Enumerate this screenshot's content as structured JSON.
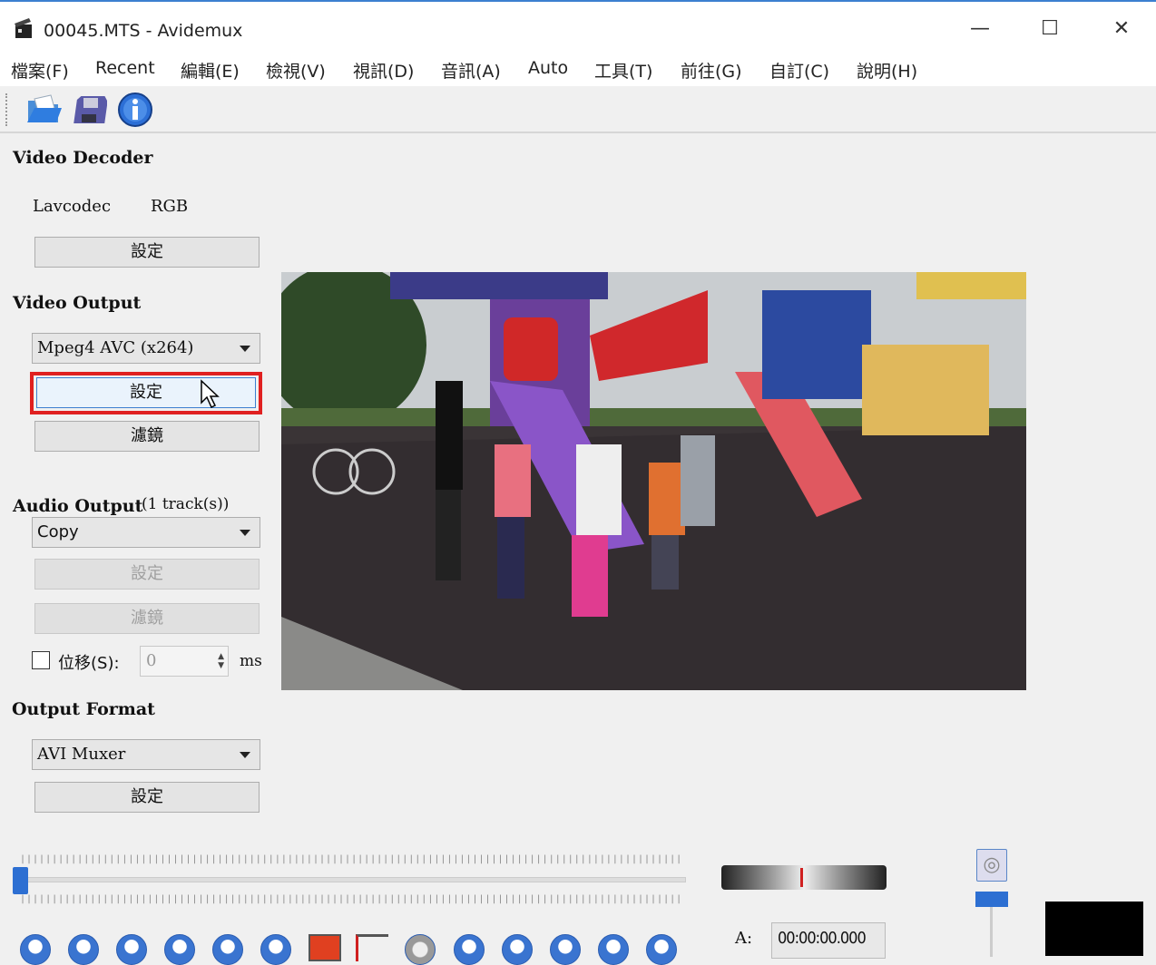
{
  "window": {
    "title": "00045.MTS - Avidemux",
    "minimize": "—",
    "maximize": "☐",
    "close": "✕"
  },
  "menu": [
    "檔案(F)",
    "Recent",
    "編輯(E)",
    "檢視(V)",
    "視訊(D)",
    "音訊(A)",
    "Auto",
    "工具(T)",
    "前往(G)",
    "自訂(C)",
    "說明(H)"
  ],
  "toolbar": {
    "icons": [
      "open-folder-icon",
      "save-floppy-icon",
      "info-icon"
    ]
  },
  "video_decoder": {
    "heading": "Video Decoder",
    "codec": "Lavcodec",
    "colorspace": "RGB",
    "configure": "設定"
  },
  "video_output": {
    "heading": "Video Output",
    "codec": "Mpeg4 AVC (x264)",
    "configure": "設定",
    "filters": "濾鏡"
  },
  "audio_output": {
    "heading": "Audio Output",
    "tracks": "(1 track(s))",
    "codec": "Copy",
    "configure": "設定",
    "filters": "濾鏡",
    "shift_label": "位移(S):",
    "shift_checked": false,
    "shift_value": "0",
    "shift_unit": "ms"
  },
  "output_format": {
    "heading": "Output Format",
    "muxer": "AVI Muxer",
    "configure": "設定"
  },
  "timeline": {
    "ticks": "||||||||||||||||||||||||||||||||||||||||||||||||||||||||||||||||||||||||||||||||||||||||||||||||||||||||||||||||||||||||||||||||||||",
    "position": 0
  },
  "playback": {
    "audio_label": "A:",
    "time": "00:00:00.000"
  },
  "colors": {
    "highlight": "#e02020",
    "accent": "#2d6fd2"
  }
}
